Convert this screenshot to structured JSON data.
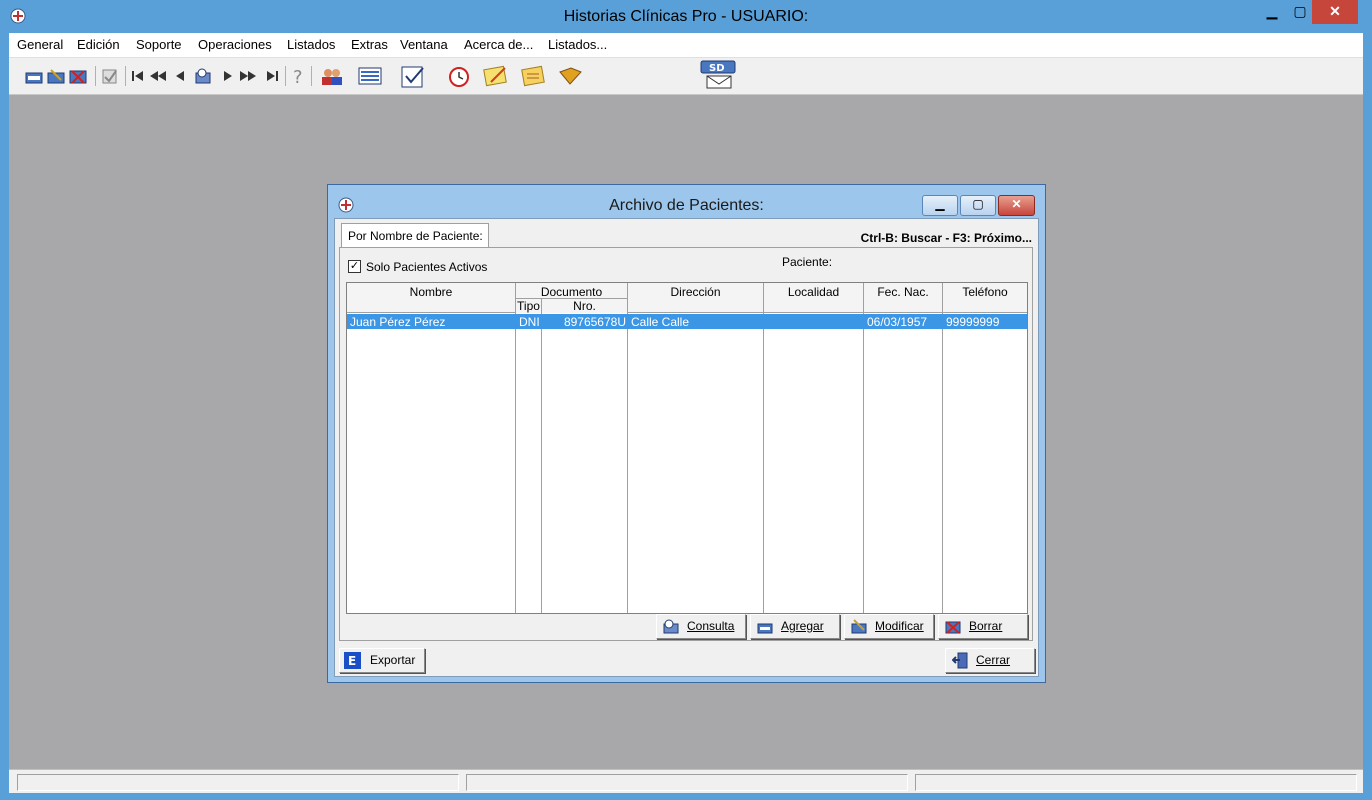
{
  "window": {
    "title": "Historias Clínicas Pro - USUARIO:",
    "controls": {
      "min": "▁",
      "max": "▢",
      "close": "✕"
    }
  },
  "menu": [
    "General",
    "Edición",
    "Soporte",
    "Operaciones",
    "Listados",
    "Extras",
    "Ventana",
    "Acerca de...",
    "Listados..."
  ],
  "toolbar_icons": [
    "new-record-icon",
    "edit-record-icon",
    "delete-record-icon",
    "check-icon",
    "first-icon",
    "prev-page-icon",
    "prev-icon",
    "search-icon",
    "next-icon",
    "next-page-icon",
    "last-icon",
    "help-icon",
    "patients-icon",
    "list-icon",
    "notepad-icon",
    "alarm-icon",
    "notes-icon",
    "notes2-icon",
    "book-icon",
    "sd-mail-icon"
  ],
  "dialog": {
    "title": "Archivo de Pacientes:",
    "tab": "Por Nombre de Paciente:",
    "hotkeys": "Ctrl-B: Buscar - F3: Próximo...",
    "only_active_label": "Solo Pacientes Activos",
    "only_active_checked": true,
    "patient_label": "Paciente:",
    "columns": {
      "nombre": "Nombre",
      "documento": "Documento",
      "tipo": "Tipo",
      "nro": "Nro.",
      "direccion": "Dirección",
      "localidad": "Localidad",
      "fec_nac": "Fec. Nac.",
      "telefono": "Teléfono"
    },
    "rows": [
      {
        "nombre": "Juan Pérez Pérez",
        "tipo": "DNI",
        "nro": "89765678U",
        "direccion": "Calle Calle",
        "localidad": "",
        "fec_nac": "06/03/1957",
        "telefono": "99999999"
      }
    ],
    "buttons": {
      "consulta": "Consulta",
      "agregar": "Agregar",
      "modificar": "Modificar",
      "borrar": "Borrar",
      "exportar": "Exportar",
      "cerrar": "Cerrar"
    },
    "export_badge": "E"
  },
  "colors": {
    "selection": "#3b96e6",
    "title_bar": "#5aa0d8",
    "workspace": "#a8a7a9"
  }
}
